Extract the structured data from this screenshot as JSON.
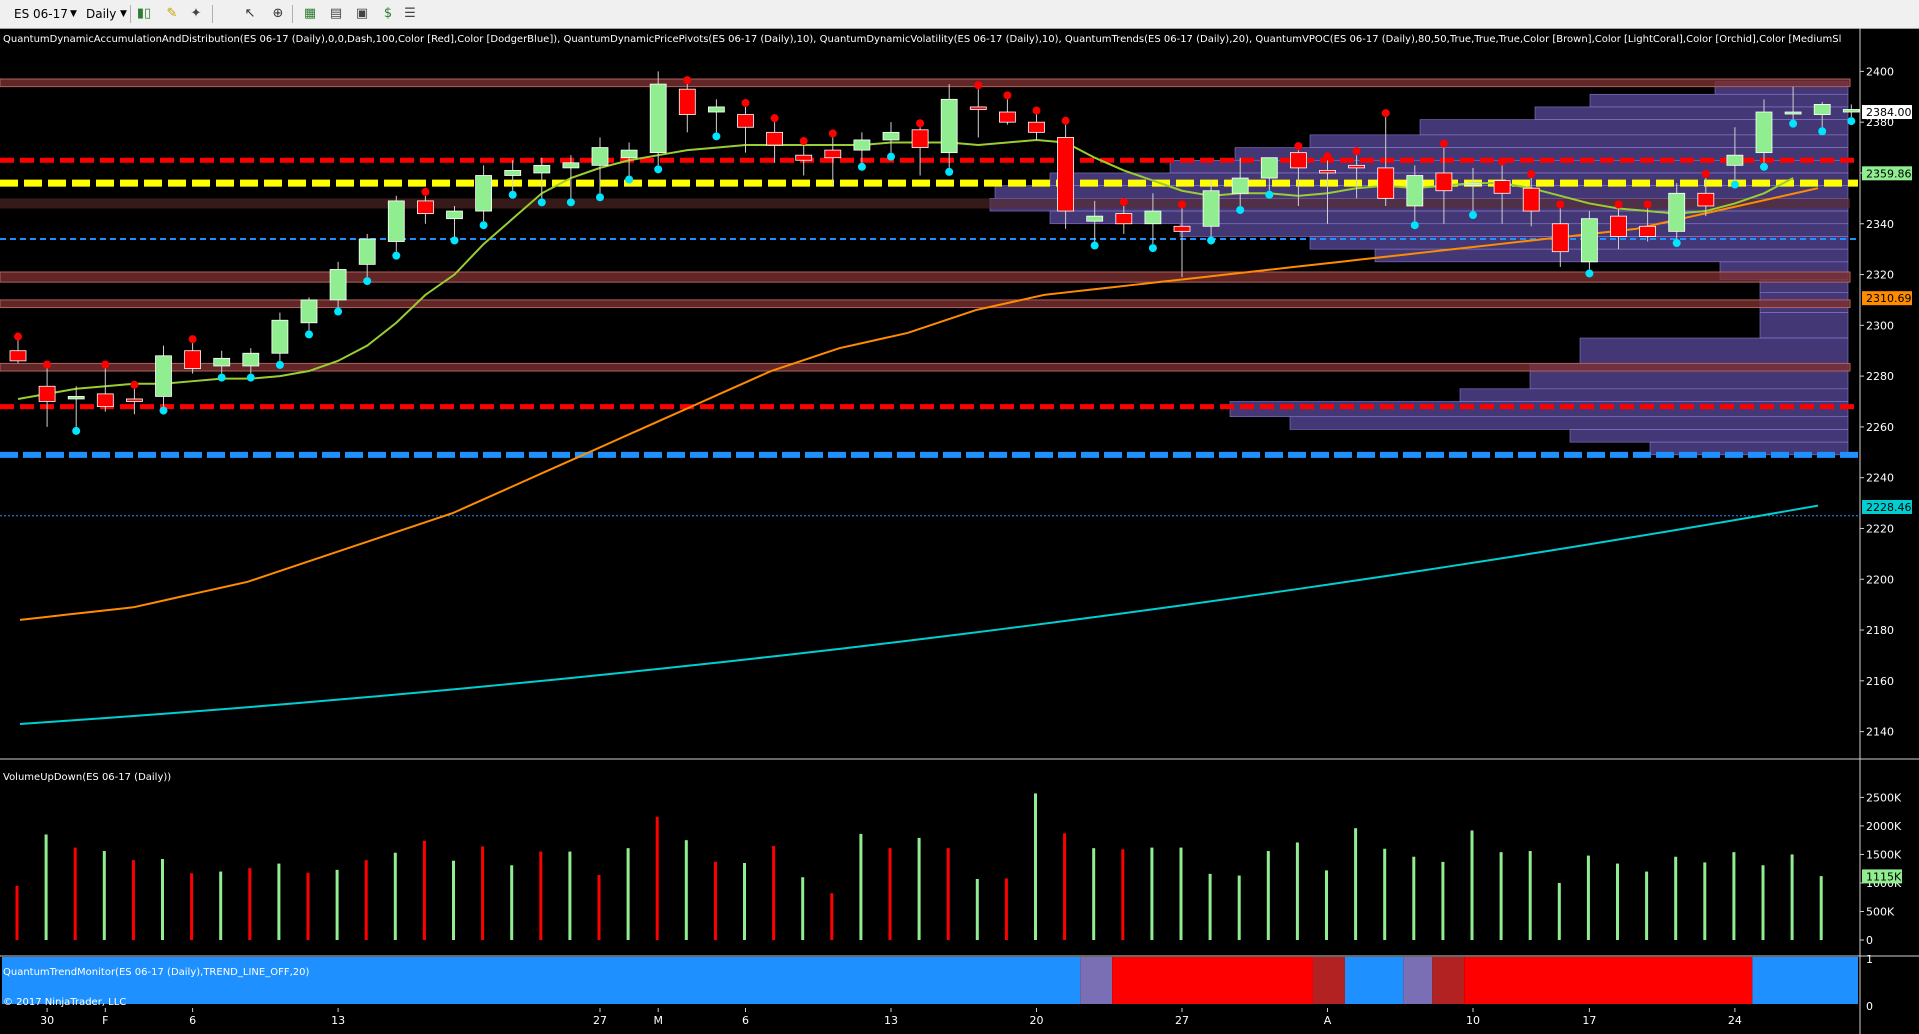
{
  "toolbar": {
    "instrument": "ES 06-17",
    "interval": "Daily",
    "icons": [
      "bar-style-icon",
      "draw-pencil-icon",
      "tools-icon",
      "pointer-icon",
      "zoom-icon",
      "chart-properties-icon",
      "indicators-icon",
      "strategies-icon",
      "data-box-icon"
    ]
  },
  "indicator_caption": "QuantumDynamicAccumulationAndDistribution(ES 06-17 (Daily),0,0,Dash,100,Color [Red],Color [DodgerBlue]), QuantumDynamicPricePivots(ES 06-17 (Daily),10), QuantumDynamicVolatility(ES 06-17 (Daily),10), QuantumTrends(ES 06-17 (Daily),20), QuantumVPOC(ES 06-17 (Daily),80,50,True,True,True,Color [Brown],Color [LightCoral],Color [Orchid],Color [MediumSl",
  "volume_caption": "VolumeUpDown(ES 06-17 (Daily))",
  "trend_caption": "QuantumTrendMonitor(ES 06-17 (Daily),TREND_LINE_OFF,20)",
  "copyright": "© 2017 NinjaTrader, LLC",
  "colors": {
    "bull": "#90ee90",
    "bear": "#ff0000",
    "ma20": "#9acd32",
    "ma_orange": "#ff8c00",
    "ma_cyan": "#00ced1",
    "vpoc": "#ffff00",
    "resistance": "#ff0000",
    "support": "#1e90ff",
    "trend_blue": "#1e90ff",
    "trend_red": "#ff0000"
  },
  "price_axis": {
    "min": 2130,
    "max": 2410,
    "ticks": [
      2400,
      2380,
      2360,
      2340,
      2320,
      2300,
      2280,
      2260,
      2240,
      2220,
      2200,
      2180,
      2160,
      2140
    ]
  },
  "price_badges": [
    {
      "value": 2384.0,
      "label": "2384.00",
      "bg": "#ffffff",
      "fg": "#000000"
    },
    {
      "value": 2359.86,
      "label": "2359.86",
      "bg": "#90ee90",
      "fg": "#000000"
    },
    {
      "value": 2310.69,
      "label": "2310.69",
      "bg": "#ff8c00",
      "fg": "#000000"
    },
    {
      "value": 2228.46,
      "label": "2228.46",
      "bg": "#00ced1",
      "fg": "#000000"
    }
  ],
  "volume_axis": {
    "max": 2700000,
    "ticks": [
      {
        "v": 2500000,
        "l": "2500K"
      },
      {
        "v": 2000000,
        "l": "2000K"
      },
      {
        "v": 1500000,
        "l": "1500K"
      },
      {
        "v": 1000000,
        "l": "1000K"
      },
      {
        "v": 500000,
        "l": "500K"
      },
      {
        "v": 0,
        "l": "0"
      }
    ],
    "badge": {
      "value": 1115000,
      "label": "1115K"
    }
  },
  "trend_axis": {
    "ticks": [
      "1",
      "0"
    ]
  },
  "date_labels": [
    {
      "i": 1,
      "l": "30"
    },
    {
      "i": 3,
      "l": "F"
    },
    {
      "i": 6,
      "l": "6"
    },
    {
      "i": 11,
      "l": "13"
    },
    {
      "i": 20,
      "l": "27"
    },
    {
      "i": 22,
      "l": "M"
    },
    {
      "i": 25,
      "l": "6"
    },
    {
      "i": 30,
      "l": "13"
    },
    {
      "i": 35,
      "l": "20"
    },
    {
      "i": 40,
      "l": "27"
    },
    {
      "i": 45,
      "l": "A"
    },
    {
      "i": 50,
      "l": "10"
    },
    {
      "i": 54,
      "l": "17"
    },
    {
      "i": 59,
      "l": "24"
    }
  ],
  "chart_data": {
    "type": "candlestick",
    "candles": [
      {
        "o": 2290,
        "h": 2294,
        "l": 2285,
        "c": 2286
      },
      {
        "o": 2276,
        "h": 2283,
        "l": 2260,
        "c": 2270
      },
      {
        "o": 2271,
        "h": 2276,
        "l": 2260,
        "c": 2272
      },
      {
        "o": 2273,
        "h": 2283,
        "l": 2266,
        "c": 2268
      },
      {
        "o": 2271,
        "h": 2275,
        "l": 2265,
        "c": 2270
      },
      {
        "o": 2272,
        "h": 2292,
        "l": 2268,
        "c": 2288
      },
      {
        "o": 2290,
        "h": 2293,
        "l": 2281,
        "c": 2283
      },
      {
        "o": 2284,
        "h": 2290,
        "l": 2281,
        "c": 2287
      },
      {
        "o": 2284,
        "h": 2291,
        "l": 2281,
        "c": 2289
      },
      {
        "o": 2289,
        "h": 2305,
        "l": 2286,
        "c": 2302
      },
      {
        "o": 2301,
        "h": 2311,
        "l": 2298,
        "c": 2310
      },
      {
        "o": 2310,
        "h": 2325,
        "l": 2307,
        "c": 2322
      },
      {
        "o": 2324,
        "h": 2336,
        "l": 2319,
        "c": 2334
      },
      {
        "o": 2333,
        "h": 2351,
        "l": 2329,
        "c": 2349
      },
      {
        "o": 2349,
        "h": 2351,
        "l": 2340,
        "c": 2344
      },
      {
        "o": 2342,
        "h": 2347,
        "l": 2335,
        "c": 2345
      },
      {
        "o": 2345,
        "h": 2363,
        "l": 2341,
        "c": 2359
      },
      {
        "o": 2359,
        "h": 2365,
        "l": 2353,
        "c": 2361
      },
      {
        "o": 2360,
        "h": 2366,
        "l": 2350,
        "c": 2363
      },
      {
        "o": 2362,
        "h": 2367,
        "l": 2350,
        "c": 2364
      },
      {
        "o": 2363,
        "h": 2374,
        "l": 2352,
        "c": 2370
      },
      {
        "o": 2366,
        "h": 2372,
        "l": 2359,
        "c": 2369
      },
      {
        "o": 2368,
        "h": 2400,
        "l": 2363,
        "c": 2395
      },
      {
        "o": 2393,
        "h": 2395,
        "l": 2376,
        "c": 2383
      },
      {
        "o": 2384,
        "h": 2389,
        "l": 2376,
        "c": 2386
      },
      {
        "o": 2383,
        "h": 2386,
        "l": 2368,
        "c": 2378
      },
      {
        "o": 2376,
        "h": 2380,
        "l": 2364,
        "c": 2371
      },
      {
        "o": 2367,
        "h": 2371,
        "l": 2359,
        "c": 2365
      },
      {
        "o": 2369,
        "h": 2374,
        "l": 2355,
        "c": 2366
      },
      {
        "o": 2369,
        "h": 2376,
        "l": 2364,
        "c": 2373
      },
      {
        "o": 2373,
        "h": 2380,
        "l": 2368,
        "c": 2376
      },
      {
        "o": 2377,
        "h": 2378,
        "l": 2359,
        "c": 2370
      },
      {
        "o": 2368,
        "h": 2395,
        "l": 2362,
        "c": 2389
      },
      {
        "o": 2386,
        "h": 2393,
        "l": 2374,
        "c": 2385
      },
      {
        "o": 2384,
        "h": 2389,
        "l": 2379,
        "c": 2380
      },
      {
        "o": 2380,
        "h": 2383,
        "l": 2373,
        "c": 2376
      },
      {
        "o": 2374,
        "h": 2379,
        "l": 2338,
        "c": 2345
      },
      {
        "o": 2341,
        "h": 2349,
        "l": 2333,
        "c": 2343
      },
      {
        "o": 2344,
        "h": 2347,
        "l": 2336,
        "c": 2340
      },
      {
        "o": 2340,
        "h": 2352,
        "l": 2332,
        "c": 2345
      },
      {
        "o": 2339,
        "h": 2346,
        "l": 2319,
        "c": 2337
      },
      {
        "o": 2339,
        "h": 2357,
        "l": 2335,
        "c": 2353
      },
      {
        "o": 2352,
        "h": 2366,
        "l": 2347,
        "c": 2358
      },
      {
        "o": 2358,
        "h": 2366,
        "l": 2353,
        "c": 2366
      },
      {
        "o": 2368,
        "h": 2369,
        "l": 2347,
        "c": 2362
      },
      {
        "o": 2361,
        "h": 2365,
        "l": 2340,
        "c": 2360
      },
      {
        "o": 2363,
        "h": 2367,
        "l": 2350,
        "c": 2362
      },
      {
        "o": 2362,
        "h": 2382,
        "l": 2347,
        "c": 2350
      },
      {
        "o": 2347,
        "h": 2363,
        "l": 2341,
        "c": 2359
      },
      {
        "o": 2360,
        "h": 2370,
        "l": 2340,
        "c": 2353
      },
      {
        "o": 2356,
        "h": 2362,
        "l": 2345,
        "c": 2356
      },
      {
        "o": 2357,
        "h": 2363,
        "l": 2340,
        "c": 2352
      },
      {
        "o": 2354,
        "h": 2358,
        "l": 2339,
        "c": 2345
      },
      {
        "o": 2340,
        "h": 2346,
        "l": 2323,
        "c": 2329
      },
      {
        "o": 2325,
        "h": 2345,
        "l": 2322,
        "c": 2342
      },
      {
        "o": 2343,
        "h": 2346,
        "l": 2330,
        "c": 2335
      },
      {
        "o": 2339,
        "h": 2346,
        "l": 2333,
        "c": 2335
      },
      {
        "o": 2337,
        "h": 2356,
        "l": 2334,
        "c": 2352
      },
      {
        "o": 2352,
        "h": 2358,
        "l": 2343,
        "c": 2347
      },
      {
        "o": 2363,
        "h": 2378,
        "l": 2357,
        "c": 2367
      },
      {
        "o": 2368,
        "h": 2389,
        "l": 2364,
        "c": 2384
      },
      {
        "o": 2384,
        "h": 2394,
        "l": 2381,
        "c": 2384
      },
      {
        "o": 2383,
        "h": 2388,
        "l": 2378,
        "c": 2387
      },
      {
        "o": 2384,
        "h": 2387,
        "l": 2382,
        "c": 2385
      }
    ],
    "ma_fast": [
      2271,
      2273,
      2275,
      2276,
      2277,
      2277,
      2278,
      2279,
      2279,
      2280,
      2282,
      2286,
      2292,
      2301,
      2312,
      2320,
      2332,
      2342,
      2352,
      2358,
      2362,
      2365,
      2367,
      2369,
      2370,
      2371,
      2371,
      2371,
      2371,
      2371,
      2372,
      2372,
      2372,
      2371,
      2372,
      2373,
      2372,
      2366,
      2361,
      2357,
      2353,
      2351,
      2352,
      2352,
      2351,
      2352,
      2354,
      2355,
      2354,
      2355,
      2356,
      2356,
      2354,
      2351,
      2348,
      2346,
      2345,
      2344,
      2345,
      2348,
      2352,
      2358
    ],
    "ma_orange": [
      2184,
      2185,
      2186,
      2187,
      2188,
      2189,
      2191,
      2193,
      2195,
      2197,
      2199,
      2202,
      2205,
      2208,
      2211,
      2214,
      2217,
      2220,
      2223,
      2226,
      2230,
      2234,
      2238,
      2242,
      2246,
      2250,
      2254,
      2258,
      2262,
      2266,
      2270,
      2274,
      2278,
      2282,
      2285,
      2288,
      2291,
      2293,
      2295,
      2297,
      2300,
      2303,
      2306,
      2308,
      2310,
      2312,
      2313,
      2314,
      2315,
      2316,
      2317,
      2318,
      2319,
      2320,
      2321,
      2322,
      2323,
      2324,
      2325,
      2326,
      2327,
      2328,
      2329,
      2330,
      2331,
      2332,
      2333,
      2334,
      2335,
      2336,
      2337,
      2338,
      2340,
      2342,
      2344,
      2346,
      2348,
      2350,
      2352,
      2354
    ],
    "ma_cyan_start": 2143,
    "ma_cyan_end": 2229,
    "levels": [
      {
        "value": 2365,
        "style": "red-dash"
      },
      {
        "value": 2356,
        "style": "yellow-dash"
      },
      {
        "value": 2334,
        "style": "blue-dash-thin"
      },
      {
        "value": 2268,
        "style": "red-dash"
      },
      {
        "value": 2249,
        "style": "blue-dash"
      },
      {
        "value": 2225,
        "style": "blue-dot-thin"
      }
    ],
    "volume": [
      950000,
      1850000,
      1620000,
      1560000,
      1400000,
      1420000,
      1170000,
      1200000,
      1260000,
      1340000,
      1180000,
      1230000,
      1400000,
      1530000,
      1740000,
      1390000,
      1640000,
      1310000,
      1550000,
      1550000,
      1140000,
      1610000,
      2160000,
      1750000,
      1370000,
      1350000,
      1650000,
      1100000,
      820000,
      1860000,
      1610000,
      1790000,
      1610000,
      1070000,
      1080000,
      2570000,
      1870000,
      1610000,
      1590000,
      1620000,
      1620000,
      1160000,
      1130000,
      1560000,
      1710000,
      1220000,
      1960000,
      1600000,
      1460000,
      1370000,
      1920000,
      1540000,
      1560000,
      1000000,
      1480000,
      1340000,
      1200000,
      1460000,
      1360000,
      1540000,
      1310000,
      1500000,
      1120000
    ],
    "trend_segments": [
      {
        "from": 0,
        "to": 36.5,
        "color": "#1e90ff"
      },
      {
        "from": 36.5,
        "to": 37.6,
        "color": "#7a6fb4"
      },
      {
        "from": 37.6,
        "to": 44.5,
        "color": "#ff0000"
      },
      {
        "from": 44.5,
        "to": 45.6,
        "color": "#b22222"
      },
      {
        "from": 45.6,
        "to": 47.6,
        "color": "#1e90ff"
      },
      {
        "from": 47.6,
        "to": 48.6,
        "color": "#7a6fb4"
      },
      {
        "from": 48.6,
        "to": 49.7,
        "color": "#b22222"
      },
      {
        "from": 49.7,
        "to": 59.6,
        "color": "#ff0000"
      },
      {
        "from": 59.6,
        "to": 63,
        "color": "#1e90ff"
      }
    ]
  }
}
